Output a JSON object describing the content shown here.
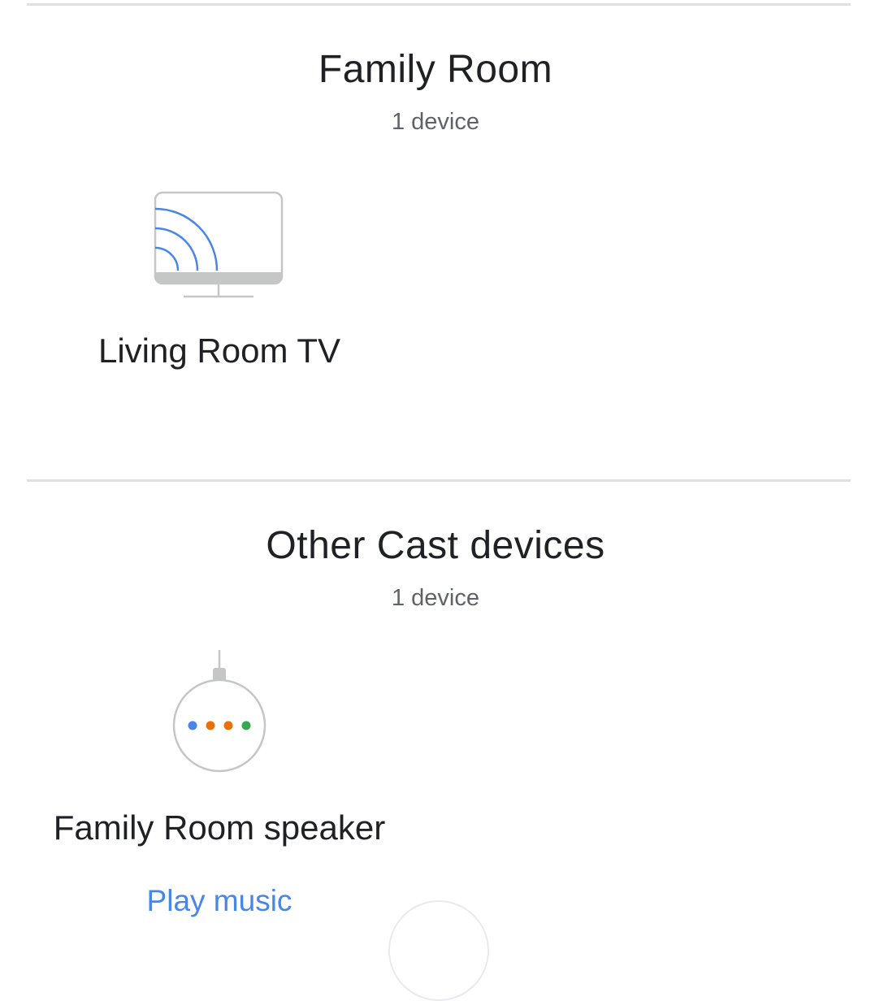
{
  "sections": [
    {
      "title": "Family Room",
      "count": "1 device",
      "devices": [
        {
          "name": "Living Room TV",
          "icon": "cast-tv-icon"
        }
      ]
    },
    {
      "title": "Other Cast devices",
      "count": "1 device",
      "devices": [
        {
          "name": "Family Room speaker",
          "icon": "smart-speaker-icon",
          "action": "Play music"
        }
      ]
    }
  ],
  "colors": {
    "accent": "#4a86e8",
    "dot_blue": "#4a86e8",
    "dot_orange": "#e8710a",
    "dot_green": "#34a853",
    "icon_gray": "#c4c7c5",
    "divider": "#e0e0e0"
  }
}
